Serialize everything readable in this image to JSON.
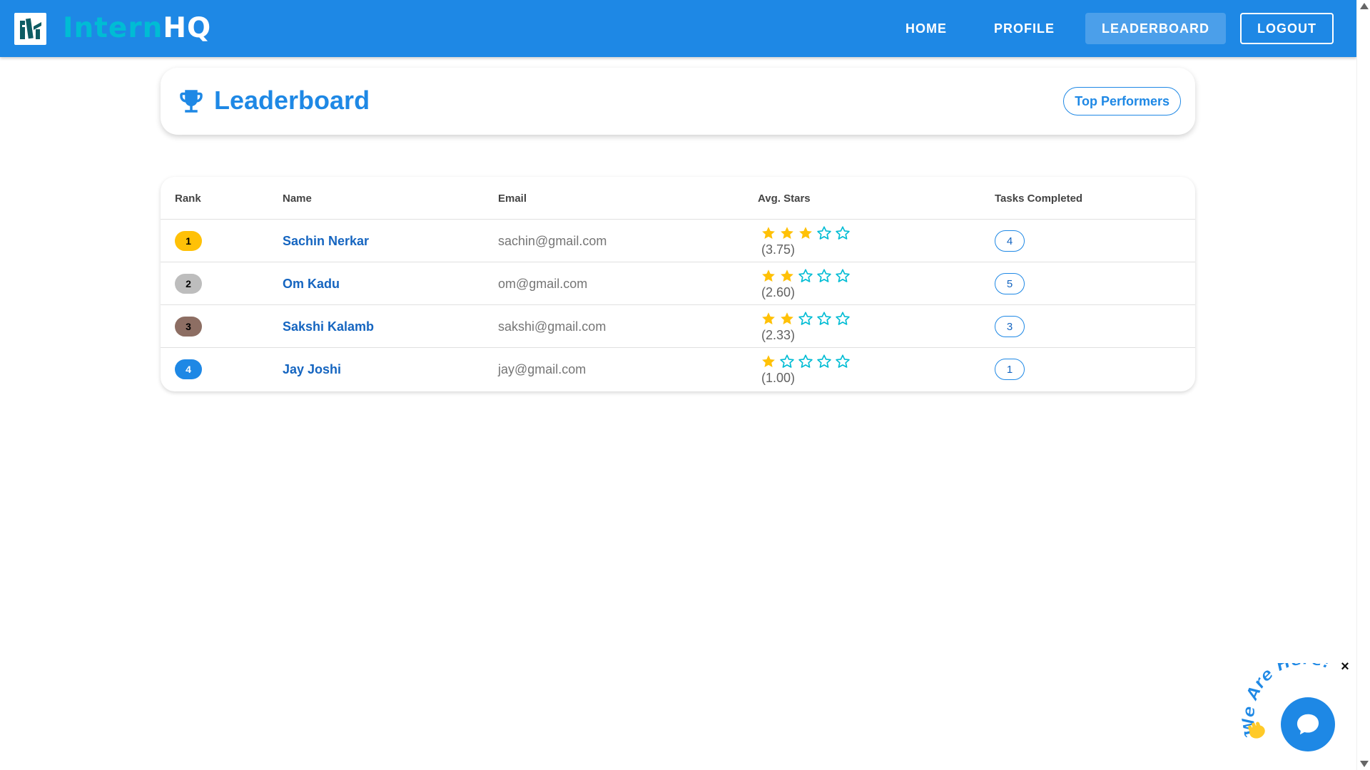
{
  "brand": {
    "part1": "Intern",
    "part2": "HQ"
  },
  "nav": {
    "home": "HOME",
    "profile": "PROFILE",
    "leaderboard": "LEADERBOARD",
    "logout": "LOGOUT"
  },
  "header": {
    "title": "Leaderboard",
    "chip": "Top Performers"
  },
  "table": {
    "headers": {
      "rank": "Rank",
      "name": "Name",
      "email": "Email",
      "stars": "Avg. Stars",
      "tasks": "Tasks Completed"
    },
    "rows": [
      {
        "rank": "1",
        "name": "Sachin Nerkar",
        "email": "sachin@gmail.com",
        "filled_stars": 3,
        "avg": "(3.75)",
        "tasks": "4"
      },
      {
        "rank": "2",
        "name": "Om Kadu",
        "email": "om@gmail.com",
        "filled_stars": 2,
        "avg": "(2.60)",
        "tasks": "5"
      },
      {
        "rank": "3",
        "name": "Sakshi Kalamb",
        "email": "sakshi@gmail.com",
        "filled_stars": 2,
        "avg": "(2.33)",
        "tasks": "3"
      },
      {
        "rank": "4",
        "name": "Jay Joshi",
        "email": "jay@gmail.com",
        "filled_stars": 1,
        "avg": "(1.00)",
        "tasks": "1"
      }
    ]
  },
  "chat": {
    "label": "We Are Here!",
    "close": "×"
  },
  "colors": {
    "primary": "#1e88e5",
    "accent": "#00bcd4",
    "rank_1": "#ffc107",
    "rank_2": "#bdbdbd",
    "rank_3": "#8d6e63",
    "rank_4": "#1e88e5",
    "star_filled": "#ffc107",
    "star_empty": "#00bcd4"
  }
}
